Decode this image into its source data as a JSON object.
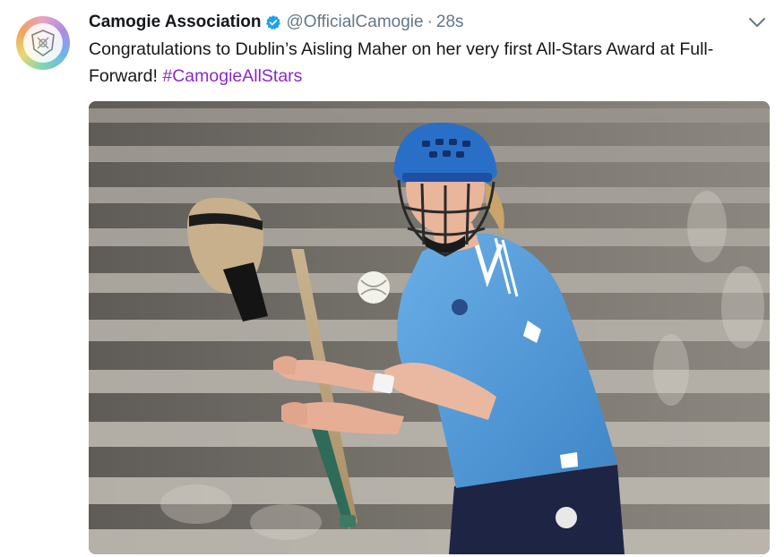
{
  "tweet": {
    "display_name": "Camogie Association",
    "handle": "@OfficialCamogie",
    "separator": "·",
    "timestamp": "28s",
    "text": "Congratulations to Dublin’s Aisling Maher on her very first All-Stars Award at Full-Forward!",
    "hashtag": "#CamogieAllStars",
    "verified": true
  },
  "icons": {
    "avatar": "camogie-crest-icon",
    "verified": "verified-badge-icon",
    "more": "chevron-down-icon"
  },
  "colors": {
    "name_text": "#14171a",
    "secondary_text": "#657786",
    "hashtag": "#8b28c9",
    "verified_blue": "#1da1f2",
    "jersey_blue": "#4f9ad6",
    "helmet_blue": "#2a6fc7",
    "shorts_navy": "#1e2444"
  },
  "media": {
    "kind": "photo",
    "subject": "camogie-player-catching-sliotar"
  }
}
